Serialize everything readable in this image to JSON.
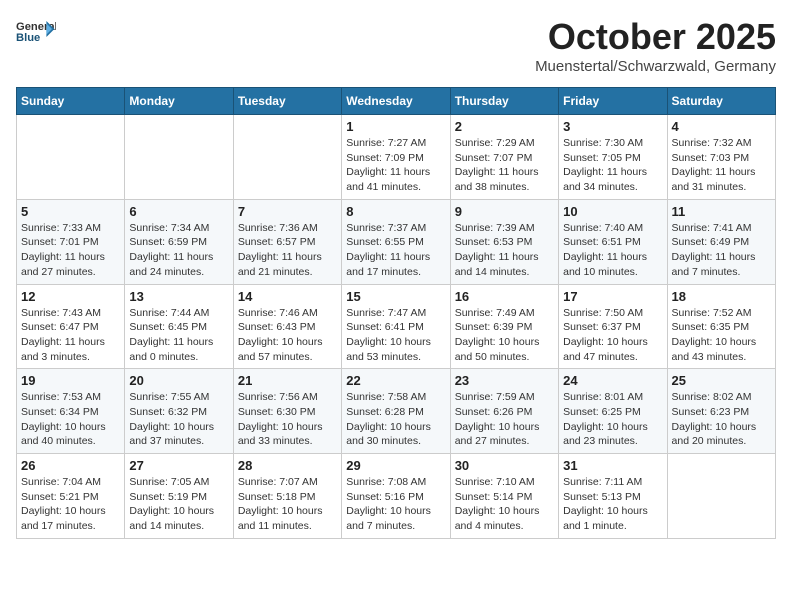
{
  "logo": {
    "general": "General",
    "blue": "Blue"
  },
  "title": "October 2025",
  "location": "Muenstertal/Schwarzwald, Germany",
  "days_of_week": [
    "Sunday",
    "Monday",
    "Tuesday",
    "Wednesday",
    "Thursday",
    "Friday",
    "Saturday"
  ],
  "weeks": [
    [
      {
        "day": "",
        "info": ""
      },
      {
        "day": "",
        "info": ""
      },
      {
        "day": "",
        "info": ""
      },
      {
        "day": "1",
        "info": "Sunrise: 7:27 AM\nSunset: 7:09 PM\nDaylight: 11 hours and 41 minutes."
      },
      {
        "day": "2",
        "info": "Sunrise: 7:29 AM\nSunset: 7:07 PM\nDaylight: 11 hours and 38 minutes."
      },
      {
        "day": "3",
        "info": "Sunrise: 7:30 AM\nSunset: 7:05 PM\nDaylight: 11 hours and 34 minutes."
      },
      {
        "day": "4",
        "info": "Sunrise: 7:32 AM\nSunset: 7:03 PM\nDaylight: 11 hours and 31 minutes."
      }
    ],
    [
      {
        "day": "5",
        "info": "Sunrise: 7:33 AM\nSunset: 7:01 PM\nDaylight: 11 hours and 27 minutes."
      },
      {
        "day": "6",
        "info": "Sunrise: 7:34 AM\nSunset: 6:59 PM\nDaylight: 11 hours and 24 minutes."
      },
      {
        "day": "7",
        "info": "Sunrise: 7:36 AM\nSunset: 6:57 PM\nDaylight: 11 hours and 21 minutes."
      },
      {
        "day": "8",
        "info": "Sunrise: 7:37 AM\nSunset: 6:55 PM\nDaylight: 11 hours and 17 minutes."
      },
      {
        "day": "9",
        "info": "Sunrise: 7:39 AM\nSunset: 6:53 PM\nDaylight: 11 hours and 14 minutes."
      },
      {
        "day": "10",
        "info": "Sunrise: 7:40 AM\nSunset: 6:51 PM\nDaylight: 11 hours and 10 minutes."
      },
      {
        "day": "11",
        "info": "Sunrise: 7:41 AM\nSunset: 6:49 PM\nDaylight: 11 hours and 7 minutes."
      }
    ],
    [
      {
        "day": "12",
        "info": "Sunrise: 7:43 AM\nSunset: 6:47 PM\nDaylight: 11 hours and 3 minutes."
      },
      {
        "day": "13",
        "info": "Sunrise: 7:44 AM\nSunset: 6:45 PM\nDaylight: 11 hours and 0 minutes."
      },
      {
        "day": "14",
        "info": "Sunrise: 7:46 AM\nSunset: 6:43 PM\nDaylight: 10 hours and 57 minutes."
      },
      {
        "day": "15",
        "info": "Sunrise: 7:47 AM\nSunset: 6:41 PM\nDaylight: 10 hours and 53 minutes."
      },
      {
        "day": "16",
        "info": "Sunrise: 7:49 AM\nSunset: 6:39 PM\nDaylight: 10 hours and 50 minutes."
      },
      {
        "day": "17",
        "info": "Sunrise: 7:50 AM\nSunset: 6:37 PM\nDaylight: 10 hours and 47 minutes."
      },
      {
        "day": "18",
        "info": "Sunrise: 7:52 AM\nSunset: 6:35 PM\nDaylight: 10 hours and 43 minutes."
      }
    ],
    [
      {
        "day": "19",
        "info": "Sunrise: 7:53 AM\nSunset: 6:34 PM\nDaylight: 10 hours and 40 minutes."
      },
      {
        "day": "20",
        "info": "Sunrise: 7:55 AM\nSunset: 6:32 PM\nDaylight: 10 hours and 37 minutes."
      },
      {
        "day": "21",
        "info": "Sunrise: 7:56 AM\nSunset: 6:30 PM\nDaylight: 10 hours and 33 minutes."
      },
      {
        "day": "22",
        "info": "Sunrise: 7:58 AM\nSunset: 6:28 PM\nDaylight: 10 hours and 30 minutes."
      },
      {
        "day": "23",
        "info": "Sunrise: 7:59 AM\nSunset: 6:26 PM\nDaylight: 10 hours and 27 minutes."
      },
      {
        "day": "24",
        "info": "Sunrise: 8:01 AM\nSunset: 6:25 PM\nDaylight: 10 hours and 23 minutes."
      },
      {
        "day": "25",
        "info": "Sunrise: 8:02 AM\nSunset: 6:23 PM\nDaylight: 10 hours and 20 minutes."
      }
    ],
    [
      {
        "day": "26",
        "info": "Sunrise: 7:04 AM\nSunset: 5:21 PM\nDaylight: 10 hours and 17 minutes."
      },
      {
        "day": "27",
        "info": "Sunrise: 7:05 AM\nSunset: 5:19 PM\nDaylight: 10 hours and 14 minutes."
      },
      {
        "day": "28",
        "info": "Sunrise: 7:07 AM\nSunset: 5:18 PM\nDaylight: 10 hours and 11 minutes."
      },
      {
        "day": "29",
        "info": "Sunrise: 7:08 AM\nSunset: 5:16 PM\nDaylight: 10 hours and 7 minutes."
      },
      {
        "day": "30",
        "info": "Sunrise: 7:10 AM\nSunset: 5:14 PM\nDaylight: 10 hours and 4 minutes."
      },
      {
        "day": "31",
        "info": "Sunrise: 7:11 AM\nSunset: 5:13 PM\nDaylight: 10 hours and 1 minute."
      },
      {
        "day": "",
        "info": ""
      }
    ]
  ]
}
